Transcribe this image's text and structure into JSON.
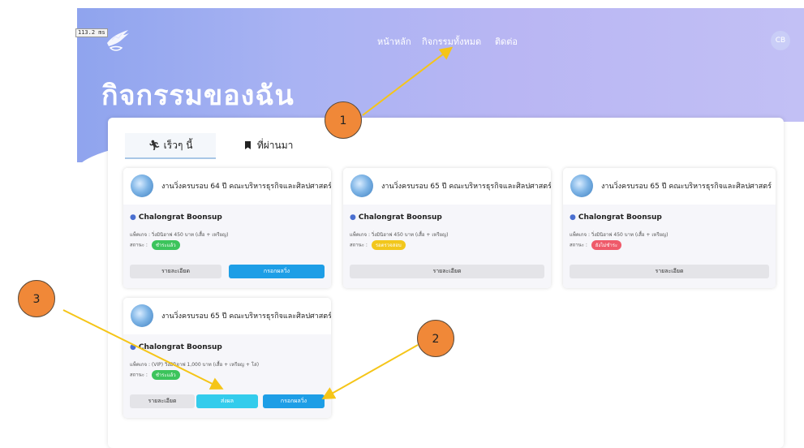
{
  "overlay": {
    "fps": "113.2 ms"
  },
  "nav": {
    "home": "หน้าหลัก",
    "all_activities": "กิจกรรมทั้งหมด",
    "contact": "ติดต่อ"
  },
  "user": {
    "initials": "CB"
  },
  "page": {
    "title": "กิจกรรมของฉัน"
  },
  "tabs": {
    "recent": "เร็วๆ นี้",
    "past": "ที่ผ่านมา"
  },
  "labels": {
    "package_prefix": "แพ็คเกจ : ",
    "status_prefix": "สถานะ : "
  },
  "cards": [
    {
      "title": "งานวิ่งครบรอบ 64 ปี คณะบริหารธุรกิจและศิลปศาสตร์",
      "name": "Chalongrat Boonsup",
      "package": "วิ่งมินิฮาฟ 450 บาท (เสื้อ + เหรียญ)",
      "status": "ชำระแล้ว",
      "status_color": "#3cc45c",
      "btn_detail": "รายละเอียด",
      "btn_result": "กรอกผลวิ่ง"
    },
    {
      "title": "งานวิ่งครบรอบ 65 ปี คณะบริหารธุรกิจและศิลปศาสตร์",
      "name": "Chalongrat Boonsup",
      "package": "วิ่งมินิฮาฟ 450 บาท (เสื้อ + เหรียญ)",
      "status": "รอตรวจสอบ",
      "status_color": "#f2c71c",
      "btn_detail": "รายละเอียด"
    },
    {
      "title": "งานวิ่งครบรอบ 65 ปี คณะบริหารธุรกิจและศิลปศาสตร์",
      "name": "Chalongrat Boonsup",
      "package": "วิ่งมินิฮาฟ 450 บาท (เสื้อ + เหรียญ)",
      "status": "ยังไม่ชำระ",
      "status_color": "#ef5a6a",
      "btn_detail": "รายละเอียด"
    },
    {
      "title": "งานวิ่งครบรอบ 65 ปี คณะบริหารธุรกิจและศิลปศาสตร์",
      "name": "Chalongrat Boonsup",
      "package": "(VIP) วิ่งมินิฮาฟ 1,000 บาท (เสื้อ + เหรียญ + โล่)",
      "status": "ชำระแล้ว",
      "status_color": "#3cc45c",
      "btn_detail": "รายละเอียด",
      "btn_submit": "ส่งผล",
      "btn_result": "กรอกผลวิ่ง"
    }
  ],
  "annotations": {
    "m1": "1",
    "m2": "2",
    "m3": "3",
    "color": "#f5c518",
    "marker_color": "#f08838"
  }
}
